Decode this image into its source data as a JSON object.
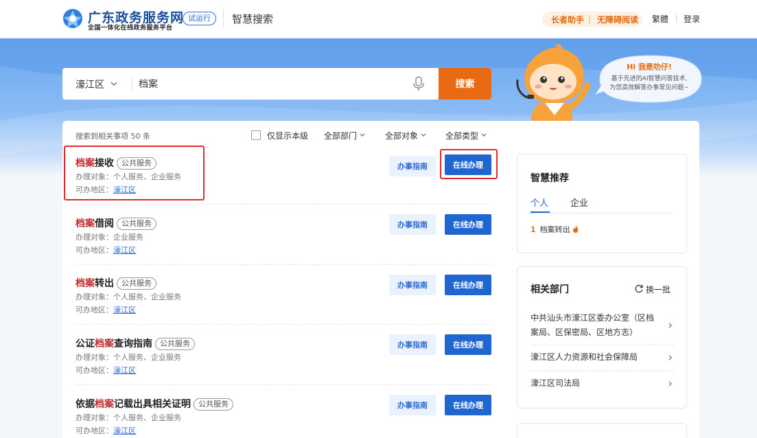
{
  "header": {
    "site_title": "广东政务服务网",
    "site_subtitle": "全国一体化在线政务服务平台",
    "trial_badge": "试运行",
    "page_title": "智慧搜索",
    "elder_mode": "长者助手",
    "accessibility": "无障碍阅读",
    "traditional": "繁體",
    "login": "登录"
  },
  "search": {
    "region": "濠江区",
    "query": "档案",
    "button": "搜索"
  },
  "mascot": {
    "greeting": "Hi 我是叻仔!",
    "line1": "基于先进的AI智慧问答技术,",
    "line2": "为您高效解答办事常见问题~"
  },
  "results": {
    "count_text": "搜索到相关事项 50 条",
    "local_only": "仅显示本级",
    "filters": [
      "全部部门",
      "全部对象",
      "全部类型"
    ],
    "guide_label": "办事指南",
    "online_label": "在线办理",
    "target_prefix": "办理对象：",
    "region_prefix": "可办地区：",
    "items": [
      {
        "title_pre": "",
        "title_hl": "档案",
        "title_post": "接收",
        "tag": "公共服务",
        "target": "个人服务、企业服务",
        "region": "濠江区"
      },
      {
        "title_pre": "",
        "title_hl": "档案",
        "title_post": "借阅",
        "tag": "公共服务",
        "target": "企业服务",
        "region": "濠江区"
      },
      {
        "title_pre": "",
        "title_hl": "档案",
        "title_post": "转出",
        "tag": "公共服务",
        "target": "个人服务、企业服务",
        "region": "濠江区"
      },
      {
        "title_pre": "公证",
        "title_hl": "档案",
        "title_post": "查询指南",
        "tag": "公共服务",
        "target": "个人服务、企业服务",
        "region": "濠江区"
      },
      {
        "title_pre": "依据",
        "title_hl": "档案",
        "title_post": "记载出具相关证明",
        "tag": "公共服务",
        "target": "个人服务、企业服务",
        "region": "濠江区"
      }
    ]
  },
  "recommend": {
    "title": "智慧推荐",
    "tab_personal": "个人",
    "tab_enterprise": "企业",
    "items": [
      {
        "rank": "1",
        "label": "档案转出"
      }
    ]
  },
  "departments": {
    "title": "相关部门",
    "refresh": "换一批",
    "items": [
      {
        "line1": "中共汕头市濠江区委办公室（区档",
        "line2": "案局、区保密局、区地方志）"
      },
      {
        "line1": "濠江区人力资源和社会保障局"
      },
      {
        "line1": "濠江区司法局"
      }
    ]
  },
  "colors": {
    "brand_blue": "#1f66d1",
    "search_orange": "#ea6a13",
    "highlight_red": "#c0282d",
    "annotation_red": "#e0282d"
  }
}
